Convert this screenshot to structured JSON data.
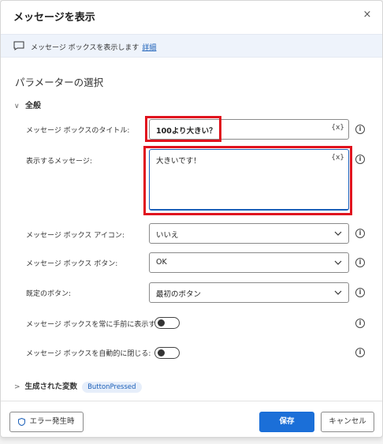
{
  "dialog": {
    "title": "メッセージを表示",
    "close_glyph": "×"
  },
  "info_bar": {
    "text": "メッセージ ボックスを表示します",
    "link": "詳細",
    "icon": "message-icon"
  },
  "params": {
    "section_title": "パラメーターの選択",
    "group_label": "全般",
    "group_chevron": "∨",
    "title_label": "メッセージ ボックスのタイトル:",
    "title_value": "100より大きい？",
    "message_label": "表示するメッセージ:",
    "message_value": "大きいです！",
    "icon_label": "メッセージ ボックス アイコン:",
    "icon_value": "いいえ",
    "buttons_label": "メッセージ ボックス ボタン:",
    "buttons_value": "OK",
    "default_button_label": "既定のボタン:",
    "default_button_value": "最初のボタン",
    "topmost_label": "メッセージ ボックスを常に手前に表示する:",
    "topmost_on": false,
    "autoclose_label": "メッセージ ボックスを自動的に閉じる:",
    "autoclose_on": false,
    "var_glyph": "{x}",
    "info_glyph": "i"
  },
  "variables": {
    "chevron": ">",
    "label": "生成された変数",
    "badge": "ButtonPressed"
  },
  "footer": {
    "error_button": "エラー発生時",
    "save_button": "保存",
    "cancel_button": "キャンセル"
  },
  "colors": {
    "accent": "#1b6fd8",
    "highlight_red": "#e0121e",
    "info_bar_bg": "#eef3fb"
  }
}
